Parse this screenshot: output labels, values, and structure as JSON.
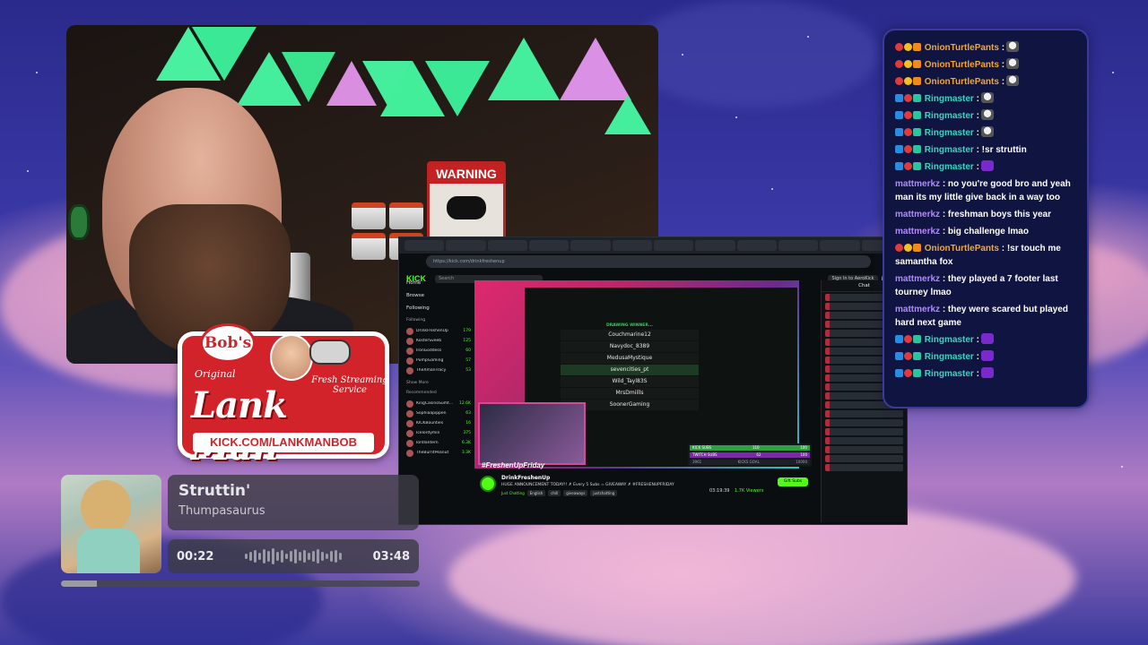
{
  "chat": {
    "messages": [
      {
        "badges": [
          "red",
          "yel",
          "org"
        ],
        "user": "OnionTurtlePants",
        "color": "orange",
        "text": ":",
        "emote": "skull"
      },
      {
        "badges": [
          "red",
          "yel",
          "org"
        ],
        "user": "OnionTurtlePants",
        "color": "orange",
        "text": ":",
        "emote": "skull"
      },
      {
        "badges": [
          "red",
          "yel",
          "org"
        ],
        "user": "OnionTurtlePants",
        "color": "orange",
        "text": ":",
        "emote": "skull"
      },
      {
        "badges": [
          "blu",
          "red",
          "grn"
        ],
        "user": "Ringmaster",
        "color": "teal",
        "text": ":",
        "emote": "skull"
      },
      {
        "badges": [
          "blu",
          "red",
          "grn"
        ],
        "user": "Ringmaster",
        "color": "teal",
        "text": ":",
        "emote": "skull"
      },
      {
        "badges": [
          "blu",
          "red",
          "grn"
        ],
        "user": "Ringmaster",
        "color": "teal",
        "text": ":",
        "emote": "skull"
      },
      {
        "badges": [
          "blu",
          "red",
          "grn"
        ],
        "user": "Ringmaster",
        "color": "teal",
        "text": ": !sr struttin",
        "emote": ""
      },
      {
        "badges": [
          "blu",
          "red",
          "grn"
        ],
        "user": "Ringmaster",
        "color": "teal",
        "text": ":",
        "emote": "purple"
      },
      {
        "badges": [],
        "user": "mattmerkz",
        "color": "purple",
        "text": ": no you're good bro and yeah man its my little give back in a way too",
        "emote": ""
      },
      {
        "badges": [],
        "user": "mattmerkz",
        "color": "purple",
        "text": ": freshman boys this year",
        "emote": ""
      },
      {
        "badges": [],
        "user": "mattmerkz",
        "color": "purple",
        "text": ": big challenge lmao",
        "emote": ""
      },
      {
        "badges": [
          "red",
          "yel",
          "org"
        ],
        "user": "OnionTurtlePants",
        "color": "orange",
        "text": ": !sr touch me samantha fox",
        "emote": ""
      },
      {
        "badges": [],
        "user": "mattmerkz",
        "color": "purple",
        "text": ": they played a 7 footer last tourney lmao",
        "emote": ""
      },
      {
        "badges": [],
        "user": "mattmerkz",
        "color": "purple",
        "text": ": they were scared but played hard next game",
        "emote": ""
      },
      {
        "badges": [
          "blu",
          "red",
          "grn"
        ],
        "user": "Ringmaster",
        "color": "teal",
        "text": ":",
        "emote": "purple"
      },
      {
        "badges": [
          "blu",
          "red",
          "grn"
        ],
        "user": "Ringmaster",
        "color": "teal",
        "text": ":",
        "emote": "purple"
      },
      {
        "badges": [
          "blu",
          "red",
          "grn"
        ],
        "user": "Ringmaster",
        "color": "teal",
        "text": ":",
        "emote": "purple"
      }
    ]
  },
  "logo": {
    "bobs": "Bob's",
    "original": "Original",
    "tagline": "Fresh Streaming Service",
    "main": "Lank Man",
    "url": "KICK.COM/LANKMANBOB"
  },
  "webcam": {
    "warning": "WARNING"
  },
  "now_playing": {
    "title": "Struttin'",
    "artist": "Thumpasaurus",
    "elapsed": "00:22",
    "duration": "03:48",
    "progress": 0.1
  },
  "screen": {
    "url": "https://kick.com/drinkfreshenup",
    "logo": "KICK",
    "search_placeholder": "Search",
    "signin": "Sign In to AeroKick",
    "nav": [
      "Home",
      "Browse",
      "Following"
    ],
    "following_label": "Following",
    "following": [
      {
        "name": "DrinkFreshenUp",
        "count": "179"
      },
      {
        "name": "KosterSveeb",
        "count": "125"
      },
      {
        "name": "IronGoddess",
        "count": "60"
      },
      {
        "name": "PumpGaming",
        "count": "57"
      },
      {
        "name": "TheXmanTracy",
        "count": "53"
      }
    ],
    "show_more": "Show More",
    "recommended_label": "Recommended",
    "recommended": [
      {
        "name": "KingCasinoSumt...",
        "count": "12.6K"
      },
      {
        "name": "Sophiaapippen",
        "count": "63"
      },
      {
        "name": "KICKBounties",
        "count": "16"
      },
      {
        "name": "Icelordymin",
        "count": "375"
      },
      {
        "name": "lordlantern",
        "count": "6.3K"
      },
      {
        "name": "TheBurntPeanut",
        "count": "3.3K"
      }
    ],
    "drawing": {
      "header": "DRAWING WINNER...",
      "entries": [
        "Couchmarine12",
        "Navydoc_8389",
        "MedusaMystique",
        "sevencities_pt",
        "Wild_Tayl83S",
        "MrsDmiills",
        "SoonerGaming"
      ],
      "selected_index": 3
    },
    "mini_tag": "#FreshenUpFriday",
    "subs": [
      {
        "label": "KICK SUBS",
        "a": "110",
        "b": "100"
      },
      {
        "label": "TWITCH SUBS",
        "a": "62",
        "b": "100"
      },
      {
        "label": "KICKS GOAL",
        "a": "3961",
        "b": "10000"
      }
    ],
    "channel": "DrinkFreshenUp",
    "stream_title": "HUGE ANNOUNCEMENT TODAY!! ✗ Every 5 Subs = GIVEAWAY ✗ #FRESHENUPFRIDAY",
    "tags": [
      "Just Chatting",
      "English",
      "chill",
      "giveaways",
      "justchatting"
    ],
    "uptime": "03:19:39",
    "viewers": "1.7K Viewers",
    "gift": "Gift Subs",
    "chat_title": "Chat"
  }
}
